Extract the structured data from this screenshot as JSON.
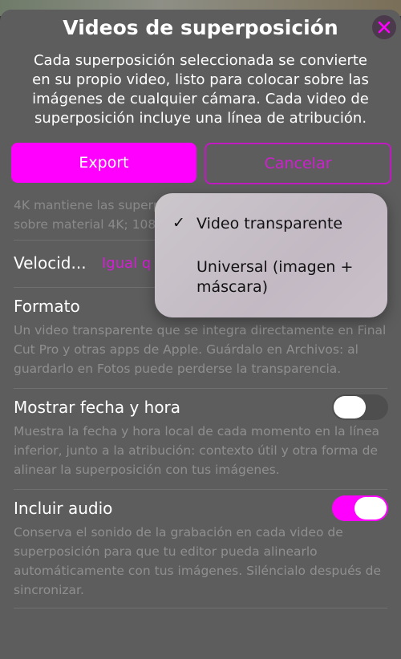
{
  "modal": {
    "title": "Videos de superposición",
    "intro": "Cada superposición seleccionada se convierte en su propio video, listo para colocar sobre las imágenes de cualquier cámara. Cada video de superposición incluye una línea de atribución."
  },
  "buttons": {
    "export": "Export",
    "cancel": "Cancelar"
  },
  "resolution": {
    "line1": "4K mantiene las superp",
    "line2": "sobre material 4K; 108"
  },
  "speed": {
    "label": "Velocid...",
    "value": "Igual q"
  },
  "format": {
    "label": "Formato",
    "description": "Un video transparente que se integra directamente en Final Cut Pro y otras apps de Apple. Guárdalo en Archivos: al guardarlo en Fotos puede perderse la transparencia."
  },
  "datetime": {
    "label": "Mostrar fecha y hora",
    "enabled": false,
    "description": "Muestra la fecha y hora local de cada momento en la línea inferior, junto a la atribución: contexto útil y otra forma de alinear la superposición con tus imágenes."
  },
  "audio": {
    "label": "Incluir audio",
    "enabled": true,
    "description": "Conserva el sonido de la grabación en cada video de superposición para que tu editor pueda alinearlo automáticamente con tus imágenes. Siléncialo después de sincronizar."
  },
  "format_menu": {
    "options": [
      "Video transparente",
      "Universal (imagen + máscara)"
    ],
    "selected": "Video transparente",
    "check": "✓"
  },
  "colors": {
    "accent": "#ff00ff",
    "toggle_off": "#4e4e4e"
  },
  "icons": {
    "close": "close-icon",
    "check": "checkmark-icon"
  }
}
